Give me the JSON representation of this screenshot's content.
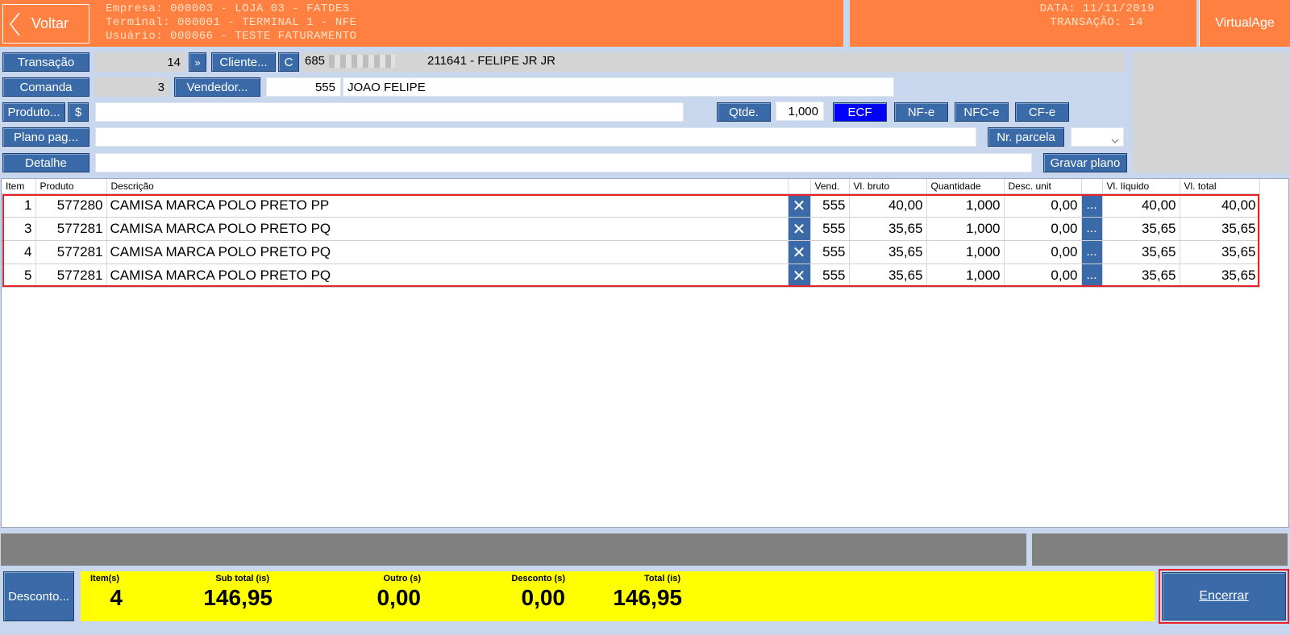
{
  "header": {
    "back_label": "Voltar",
    "empresa": "Empresa: 000003 - LOJA 03 - FATDES",
    "terminal": "Terminal: 000001 - TERMINAL 1 - NFE",
    "usuario": "Usuário: 000066 - TESTE FATURAMENTO",
    "data": "DATA: 11/11/2019",
    "transacao": "TRANSAÇÃO: 14",
    "brand": "VirtualAge"
  },
  "form": {
    "transacao_btn": "Transação",
    "transacao_value": "14",
    "transacao_nav": "»",
    "cliente_btn": "Cliente...",
    "cliente_c": "C",
    "cliente_code": "685",
    "cliente_name": "211641 - FELIPE JR JR",
    "comanda_btn": "Comanda",
    "comanda_value": "3",
    "vendedor_btn": "Vendedor...",
    "vendedor_code": "555",
    "vendedor_name": "JOAO FELIPE",
    "produto_btn": "Produto...",
    "produto_dollar": "$",
    "produto_value": "",
    "qtde_btn": "Qtde.",
    "qtde_value": "1,000",
    "ecf": "ECF",
    "nfe": "NF-e",
    "nfce": "NFC-e",
    "cfe": "CF-e",
    "plano_btn": "Plano pag...",
    "plano_value": "",
    "nr_parcela_btn": "Nr. parcela",
    "nr_parcela_value": "",
    "detalhe_btn": "Detalhe",
    "detalhe_value": "",
    "gravar_plano_btn": "Gravar plano"
  },
  "table": {
    "headers": [
      "Item",
      "Produto",
      "Descrição",
      "",
      "Vend.",
      "Vl. bruto",
      "Quantidade",
      "Desc. unit",
      "",
      "Vl. líquido",
      "Vl. total"
    ],
    "rows": [
      [
        "1",
        "577280",
        "CAMISA MARCA POLO PRETO PP",
        "✕",
        "555",
        "40,00",
        "1,000",
        "0,00",
        "...",
        "40,00",
        "40,00"
      ],
      [
        "3",
        "577281",
        "CAMISA MARCA POLO PRETO PQ",
        "✕",
        "555",
        "35,65",
        "1,000",
        "0,00",
        "...",
        "35,65",
        "35,65"
      ],
      [
        "4",
        "577281",
        "CAMISA MARCA POLO PRETO PQ",
        "✕",
        "555",
        "35,65",
        "1,000",
        "0,00",
        "...",
        "35,65",
        "35,65"
      ],
      [
        "5",
        "577281",
        "CAMISA MARCA POLO PRETO PQ",
        "✕",
        "555",
        "35,65",
        "1,000",
        "0,00",
        "...",
        "35,65",
        "35,65"
      ]
    ]
  },
  "footer": {
    "desconto_btn": "Desconto...",
    "itens_label": "Item(s)",
    "itens_value": "4",
    "subtotal_label": "Sub total (is)",
    "subtotal_value": "146,95",
    "outro_label": "Outro (s)",
    "outro_value": "0,00",
    "desconto_label": "Desconto (s)",
    "desconto_value": "0,00",
    "total_label": "Total (is)",
    "total_value": "146,95",
    "encerrar_btn": "Encerrar"
  },
  "colors": {
    "header": "#ff8040",
    "button": "#3a6aa8",
    "selected_doc": "#0000ff",
    "totals_bg": "#ffff00",
    "highlight": "#e8202a"
  }
}
